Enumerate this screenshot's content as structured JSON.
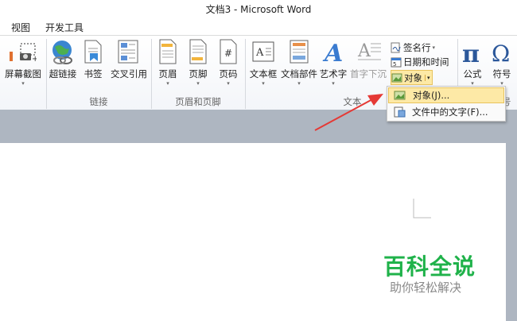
{
  "window": {
    "title": "文档3 - Microsoft Word"
  },
  "tabs": [
    "视图",
    "开发工具"
  ],
  "ribbon": {
    "buttons": {
      "screenshot": "屏幕截图",
      "hyperlink": "超链接",
      "bookmark": "书签",
      "crossref": "交叉引用",
      "header": "页眉",
      "footer": "页脚",
      "pagenumber": "页码",
      "textbox": "文本框",
      "quickparts": "文档部件",
      "wordart": "艺术字",
      "dropcap": "首字下沉",
      "equation": "公式",
      "symbol": "符号"
    },
    "small": {
      "signature": "签名行",
      "datetime": "日期和时间",
      "object": "对象"
    },
    "groups": {
      "links": "链接",
      "headerfooter": "页眉和页脚",
      "text": "文本",
      "symbols": "符号"
    }
  },
  "dropdown": {
    "item1": "对象(J)...",
    "item2": "文件中的文字(F)..."
  },
  "watermark": {
    "title": "百科全说",
    "subtitle": "助你轻松解决"
  },
  "colors": {
    "accent": "#2b579a",
    "highlight": "#fde9a6",
    "arrow": "#e53935",
    "watermark_green": "#1fb24a"
  }
}
